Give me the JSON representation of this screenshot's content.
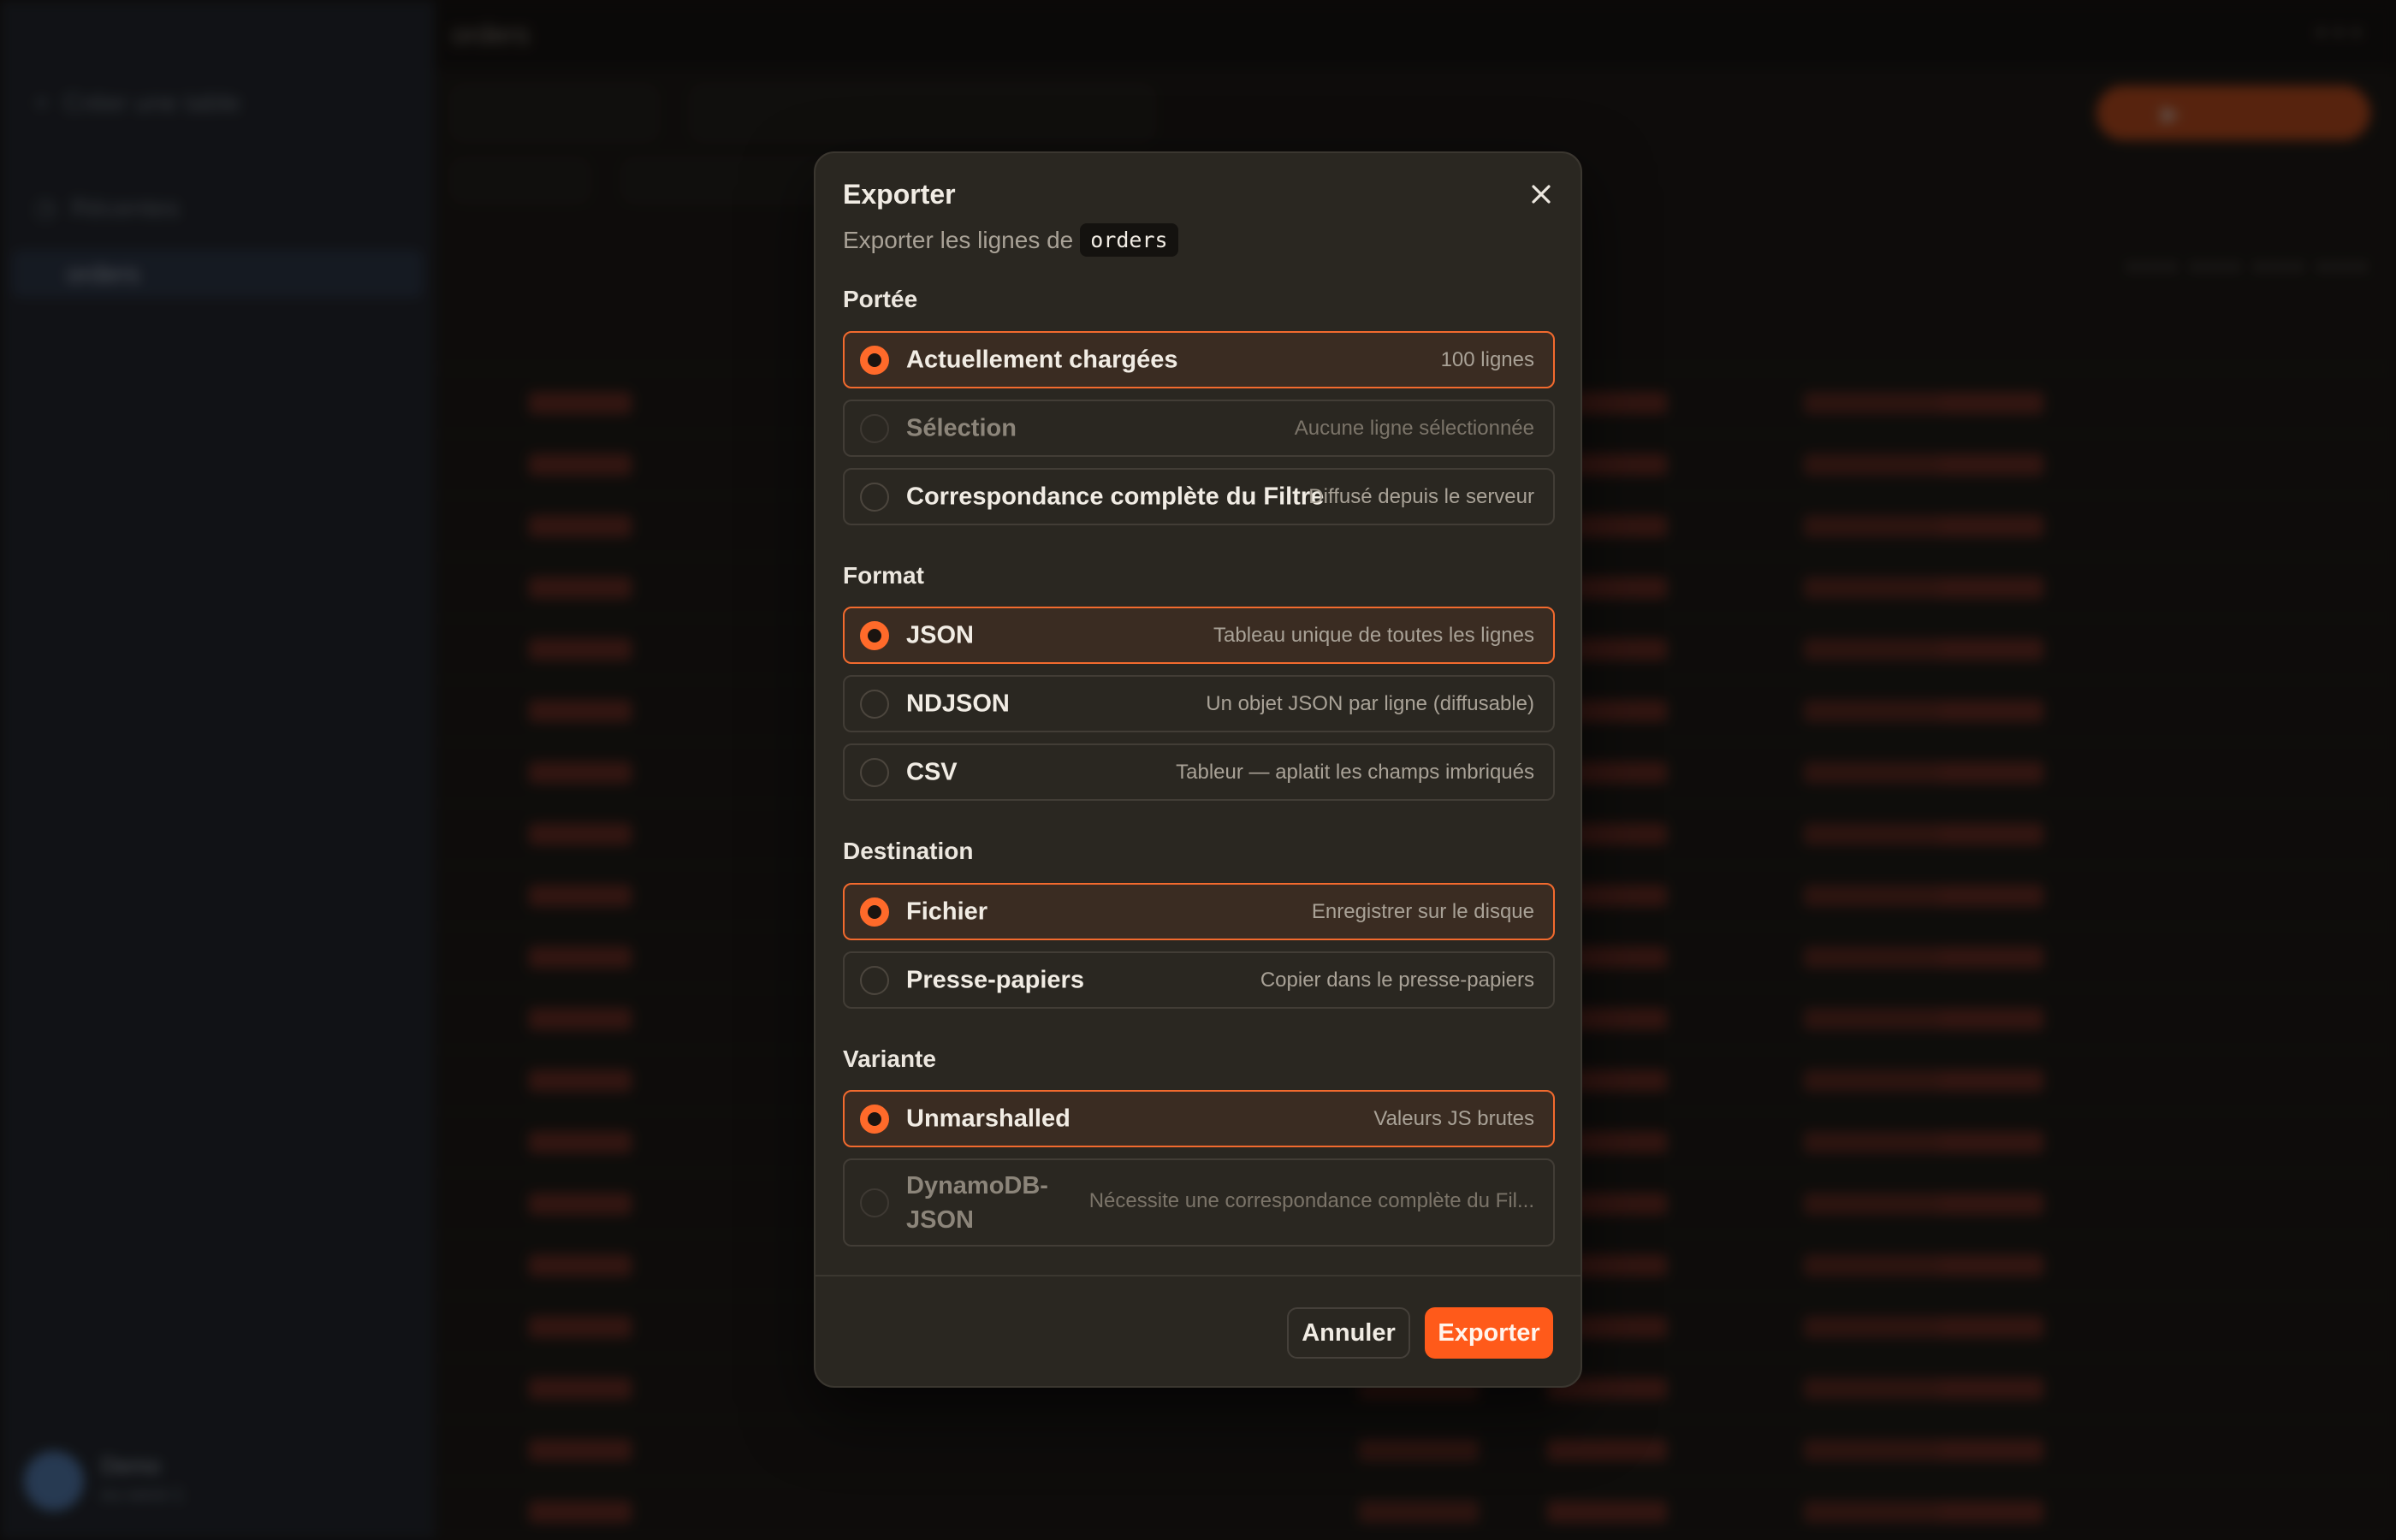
{
  "modal": {
    "title": "Exporter",
    "subtitle": "Exporter les lignes de",
    "table_name": "orders",
    "close_icon": "close-icon",
    "sections": {
      "scope": {
        "label": "Portée",
        "options": [
          {
            "label": "Actuellement chargées",
            "desc": "100 lignes",
            "selected": true,
            "disabled": false
          },
          {
            "label": "Sélection",
            "desc": "Aucune ligne sélectionnée",
            "selected": false,
            "disabled": true
          },
          {
            "label": "Correspondance complète du Filtre",
            "desc": "Diffusé depuis le serveur",
            "selected": false,
            "disabled": false
          }
        ]
      },
      "format": {
        "label": "Format",
        "options": [
          {
            "label": "JSON",
            "desc": "Tableau unique de toutes les lignes",
            "selected": true,
            "disabled": false
          },
          {
            "label": "NDJSON",
            "desc": "Un objet JSON par ligne (diffusable)",
            "selected": false,
            "disabled": false
          },
          {
            "label": "CSV",
            "desc": "Tableur — aplatit les champs imbriqués",
            "selected": false,
            "disabled": false
          }
        ]
      },
      "destination": {
        "label": "Destination",
        "options": [
          {
            "label": "Fichier",
            "desc": "Enregistrer sur le disque",
            "selected": true,
            "disabled": false
          },
          {
            "label": "Presse-papiers",
            "desc": "Copier dans le presse-papiers",
            "selected": false,
            "disabled": false
          }
        ]
      },
      "variant": {
        "label": "Variante",
        "options": [
          {
            "label": "Unmarshalled",
            "desc": "Valeurs JS brutes",
            "selected": true,
            "disabled": false
          },
          {
            "label": "DynamoDB-JSON",
            "desc": "Nécessite une correspondance complète du Fil...",
            "selected": false,
            "disabled": true
          }
        ]
      }
    },
    "footer": {
      "cancel_label": "Annuler",
      "export_label": "Exporter"
    }
  },
  "colors": {
    "accent": "#ff5a1a",
    "modal_bg": "#2a2721",
    "selected_border": "#f26a2e"
  }
}
